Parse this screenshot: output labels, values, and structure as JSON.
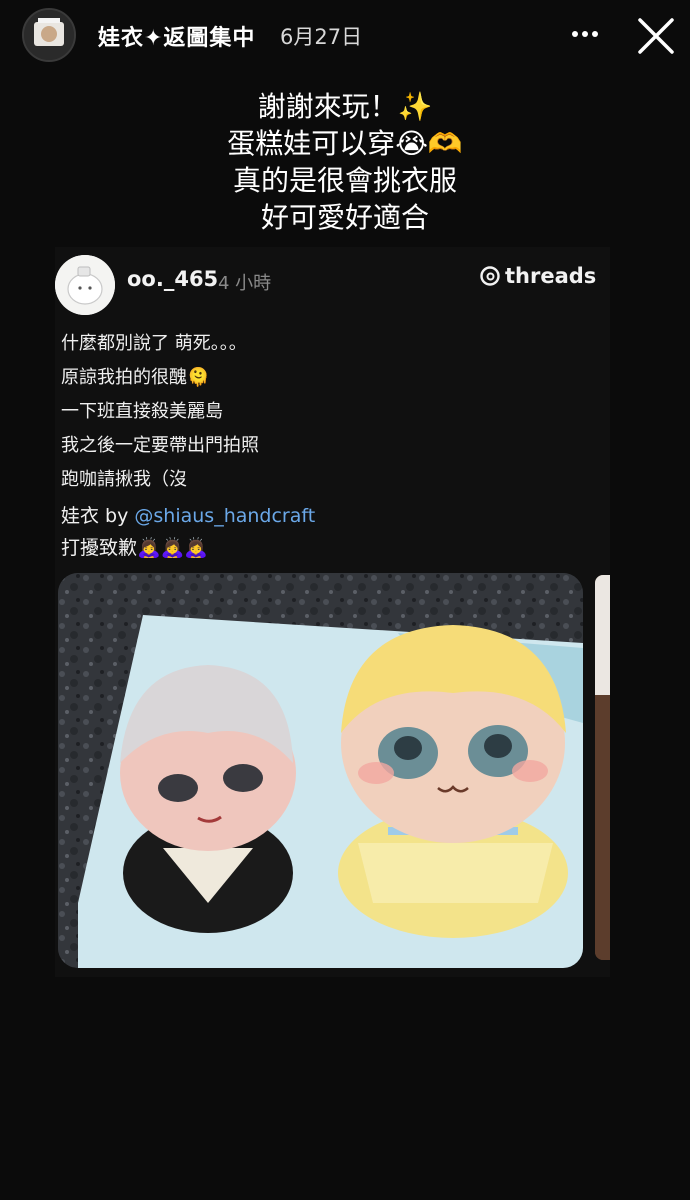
{
  "story": {
    "username": "娃衣✦返圖集中",
    "date": "6月27日",
    "more_icon": "more-icon",
    "close_icon": "close-icon"
  },
  "caption": {
    "lines": [
      "謝謝來玩！✨",
      "蛋糕娃可以穿😭🫶",
      "真的是很會挑衣服",
      "好可愛好適合"
    ]
  },
  "threads_post": {
    "username": "oo._465",
    "time": "4 小時",
    "brand": "threads",
    "body_lines": [
      "什麼都別說了 萌死。。。",
      "原諒我拍的很醜🫠",
      "一下班直接殺美麗島",
      "我之後一定要帶出門拍照",
      "跑咖請揪我（沒"
    ],
    "credit_prefix": "娃衣 by ",
    "credit_mention": "@shiaus_handcraft",
    "apology": "打擾致歉🙇‍♀️🙇‍♀️🙇‍♀️"
  },
  "colors": {
    "background": "#0b0b0b",
    "mention": "#6ba8e8"
  }
}
